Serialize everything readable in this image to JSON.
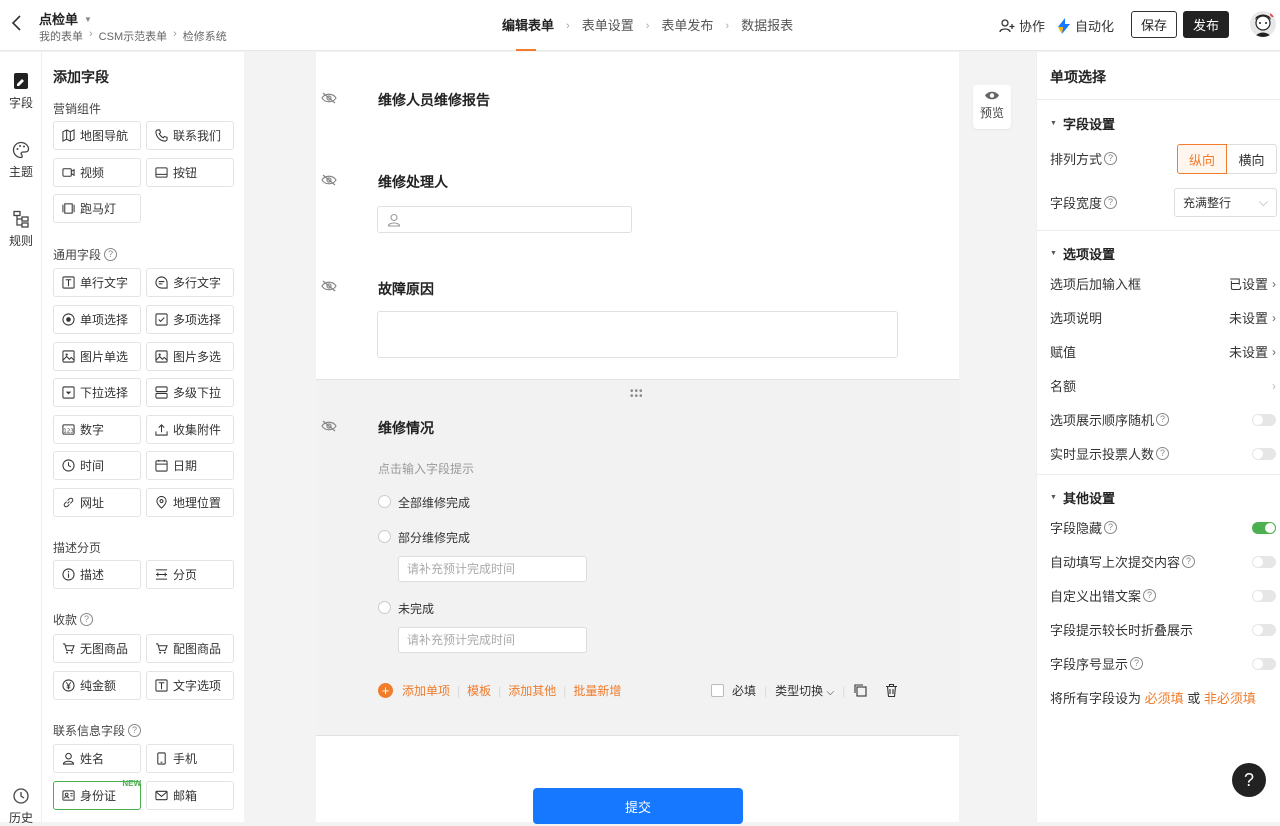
{
  "topbar": {
    "app_name": "点检单",
    "breadcrumb": [
      "我的表单",
      "CSM示范表单",
      "检修系统"
    ],
    "steps": [
      "编辑表单",
      "表单设置",
      "表单发布",
      "数据报表"
    ],
    "collab_label": "协作",
    "automation_label": "自动化",
    "save_label": "保存",
    "publish_label": "发布"
  },
  "leftnav": {
    "items": [
      "字段",
      "主题",
      "规则"
    ],
    "history_label": "历史"
  },
  "field_panel": {
    "title": "添加字段",
    "sections": [
      {
        "label": "营销组件",
        "items": [
          "地图导航",
          "联系我们",
          "视频",
          "按钮",
          "跑马灯"
        ]
      },
      {
        "label": "通用字段",
        "items": [
          "单行文字",
          "多行文字",
          "单项选择",
          "多项选择",
          "图片单选",
          "图片多选",
          "下拉选择",
          "多级下拉",
          "数字",
          "收集附件",
          "时间",
          "日期",
          "网址",
          "地理位置"
        ]
      },
      {
        "label": "描述分页",
        "items": [
          "描述",
          "分页"
        ]
      },
      {
        "label": "收款",
        "items": [
          "无图商品",
          "配图商品",
          "纯金额",
          "文字选项"
        ]
      },
      {
        "label": "联系信息字段",
        "items": [
          "姓名",
          "手机",
          "身份证",
          "邮箱"
        ]
      }
    ],
    "new_badge": "NEW"
  },
  "canvas": {
    "fields": [
      {
        "title": "维修人员维修报告"
      },
      {
        "title": "维修处理人"
      },
      {
        "title": "故障原因"
      }
    ],
    "active_field": {
      "title": "维修情况",
      "hint": "点击输入字段提示",
      "options": [
        "全部维修完成",
        "部分维修完成",
        "未完成"
      ],
      "extra_placeholder": "请补充预计完成时间",
      "actions": [
        "添加单项",
        "模板",
        "添加其他",
        "批量新增"
      ],
      "required_label": "必填",
      "type_switch_label": "类型切换"
    },
    "submit_label": "提交",
    "preview_label": "预览"
  },
  "right_panel": {
    "title": "单项选择",
    "field_settings": {
      "section": "字段设置",
      "layout_label": "排列方式",
      "layout_options": [
        "纵向",
        "横向"
      ],
      "layout_selected": "纵向",
      "width_label": "字段宽度",
      "width_value": "充满整行"
    },
    "option_settings": {
      "section": "选项设置",
      "rows": [
        {
          "label": "选项后加输入框",
          "value": "已设置"
        },
        {
          "label": "选项说明",
          "value": "未设置"
        },
        {
          "label": "赋值",
          "value": "未设置"
        },
        {
          "label": "名额",
          "value": ""
        }
      ],
      "toggles": [
        {
          "label": "选项展示顺序随机",
          "on": false
        },
        {
          "label": "实时显示投票人数",
          "on": false
        }
      ]
    },
    "other_settings": {
      "section": "其他设置",
      "toggles": [
        {
          "label": "字段隐藏",
          "on": true
        },
        {
          "label": "自动填写上次提交内容",
          "on": false
        },
        {
          "label": "自定义出错文案",
          "on": false
        },
        {
          "label": "字段提示较长时折叠展示",
          "on": false
        },
        {
          "label": "字段序号显示",
          "on": false
        }
      ]
    },
    "all_required": {
      "prefix": "将所有字段设为",
      "required": "必须填",
      "or": "或",
      "optional": "非必须填"
    }
  },
  "help_label": "?",
  "colors": {
    "accent": "#f07c2c",
    "primary": "#1677ff",
    "toggle_on": "#4caf50"
  }
}
